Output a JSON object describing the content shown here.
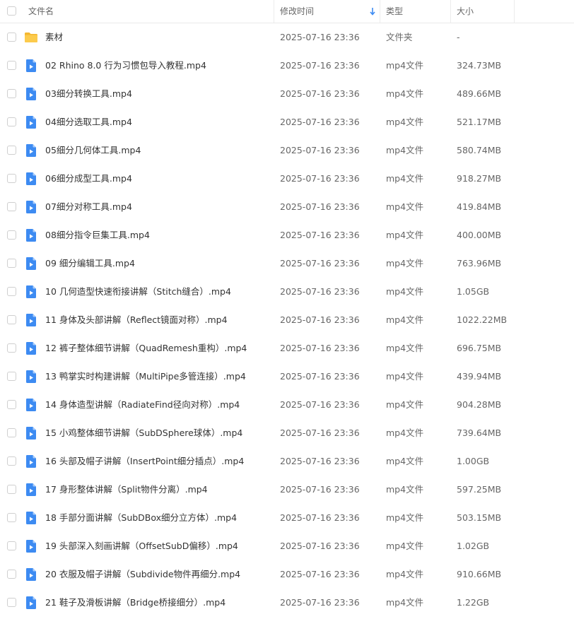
{
  "header": {
    "name": "文件名",
    "modified": "修改时间",
    "type": "类型",
    "size": "大小"
  },
  "colors": {
    "accent": "#3d8bf2",
    "folder": "#f9c440"
  },
  "files": [
    {
      "name": "素材",
      "date": "2025-07-16 23:36",
      "type": "文件夹",
      "size": "-",
      "icon": "folder-icon"
    },
    {
      "name": "02 Rhino 8.0 行为习惯包导入教程.mp4",
      "date": "2025-07-16 23:36",
      "type": "mp4文件",
      "size": "324.73MB",
      "icon": "video-file-icon"
    },
    {
      "name": "03细分转换工具.mp4",
      "date": "2025-07-16 23:36",
      "type": "mp4文件",
      "size": "489.66MB",
      "icon": "video-file-icon"
    },
    {
      "name": "04细分选取工具.mp4",
      "date": "2025-07-16 23:36",
      "type": "mp4文件",
      "size": "521.17MB",
      "icon": "video-file-icon"
    },
    {
      "name": "05细分几何体工具.mp4",
      "date": "2025-07-16 23:36",
      "type": "mp4文件",
      "size": "580.74MB",
      "icon": "video-file-icon"
    },
    {
      "name": "06细分成型工具.mp4",
      "date": "2025-07-16 23:36",
      "type": "mp4文件",
      "size": "918.27MB",
      "icon": "video-file-icon"
    },
    {
      "name": "07细分对称工具.mp4",
      "date": "2025-07-16 23:36",
      "type": "mp4文件",
      "size": "419.84MB",
      "icon": "video-file-icon"
    },
    {
      "name": "08细分指令巨集工具.mp4",
      "date": "2025-07-16 23:36",
      "type": "mp4文件",
      "size": "400.00MB",
      "icon": "video-file-icon"
    },
    {
      "name": "09  细分编辑工具.mp4",
      "date": "2025-07-16 23:36",
      "type": "mp4文件",
      "size": "763.96MB",
      "icon": "video-file-icon"
    },
    {
      "name": "10 几何造型快速衔接讲解（Stitch缝合）.mp4",
      "date": "2025-07-16 23:36",
      "type": "mp4文件",
      "size": "1.05GB",
      "icon": "video-file-icon"
    },
    {
      "name": "11 身体及头部讲解（Reflect镜面对称）.mp4",
      "date": "2025-07-16 23:36",
      "type": "mp4文件",
      "size": "1022.22MB",
      "icon": "video-file-icon"
    },
    {
      "name": "12 裤子整体细节讲解（QuadRemesh重构）.mp4",
      "date": "2025-07-16 23:36",
      "type": "mp4文件",
      "size": "696.75MB",
      "icon": "video-file-icon"
    },
    {
      "name": "13 鸭掌实时构建讲解（MultiPipe多管连接）.mp4",
      "date": "2025-07-16 23:36",
      "type": "mp4文件",
      "size": "439.94MB",
      "icon": "video-file-icon"
    },
    {
      "name": "14 身体造型讲解（RadiateFind径向对称）.mp4",
      "date": "2025-07-16 23:36",
      "type": "mp4文件",
      "size": "904.28MB",
      "icon": "video-file-icon"
    },
    {
      "name": "15 小鸡整体细节讲解（SubDSphere球体）.mp4",
      "date": "2025-07-16 23:36",
      "type": "mp4文件",
      "size": "739.64MB",
      "icon": "video-file-icon"
    },
    {
      "name": "16 头部及帽子讲解（InsertPoint细分插点）.mp4",
      "date": "2025-07-16 23:36",
      "type": "mp4文件",
      "size": "1.00GB",
      "icon": "video-file-icon"
    },
    {
      "name": "17 身形整体讲解（Split物件分离）.mp4",
      "date": "2025-07-16 23:36",
      "type": "mp4文件",
      "size": "597.25MB",
      "icon": "video-file-icon"
    },
    {
      "name": "18 手部分面讲解（SubDBox细分立方体）.mp4",
      "date": "2025-07-16 23:36",
      "type": "mp4文件",
      "size": "503.15MB",
      "icon": "video-file-icon"
    },
    {
      "name": "19 头部深入刻画讲解（OffsetSubD偏移）.mp4",
      "date": "2025-07-16 23:36",
      "type": "mp4文件",
      "size": "1.02GB",
      "icon": "video-file-icon"
    },
    {
      "name": "20 衣服及帽子讲解（Subdivide物件再细分.mp4",
      "date": "2025-07-16 23:36",
      "type": "mp4文件",
      "size": "910.66MB",
      "icon": "video-file-icon"
    },
    {
      "name": "21 鞋子及滑板讲解（Bridge桥接细分）.mp4",
      "date": "2025-07-16 23:36",
      "type": "mp4文件",
      "size": "1.22GB",
      "icon": "video-file-icon"
    }
  ]
}
